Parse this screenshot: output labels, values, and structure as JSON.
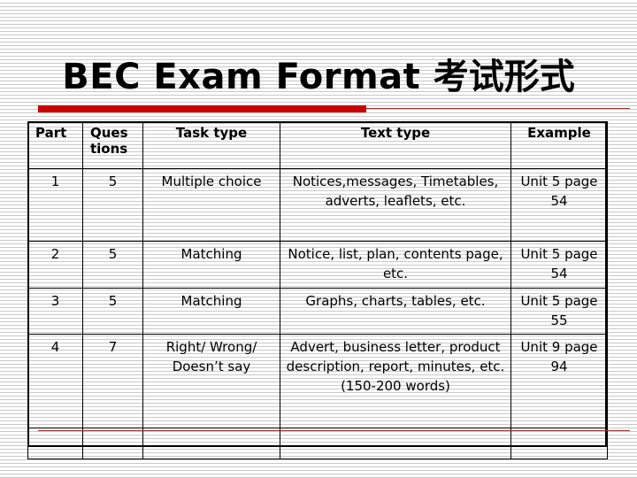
{
  "slide": {
    "title_en": "BEC  Exam Format ",
    "title_cjk": "考试形式"
  },
  "table": {
    "headers": [
      "Part",
      "Ques tions",
      "Task type",
      "Text type",
      "Example"
    ],
    "rows": [
      {
        "part": "1",
        "questions": "5",
        "task_type": "Multiple choice",
        "text_type": "Notices,messages, Timetables, adverts, leaflets, etc.",
        "example": "Unit 5 page 54"
      },
      {
        "part": "2",
        "questions": "5",
        "task_type": "Matching",
        "text_type": "Notice, list, plan, contents page, etc.",
        "example": "Unit 5 page 54"
      },
      {
        "part": "3",
        "questions": "5",
        "task_type": "Matching",
        "text_type": "Graphs, charts, tables, etc.",
        "example": "Unit 5 page 55"
      },
      {
        "part": "4",
        "questions": "7",
        "task_type": "Right/ Wrong/ Doesn’t say",
        "text_type": "Advert, business letter, product description, report, minutes, etc. (150-200 words)",
        "example": "Unit 9 page 94"
      }
    ],
    "empty_row": {
      "part": "",
      "questions": "",
      "task_type": "",
      "text_type": "",
      "example": ""
    }
  },
  "decoration": {
    "accent_red": "#CC0000",
    "rule_red": "#993333",
    "background_stripe": "#c9c9c9"
  }
}
